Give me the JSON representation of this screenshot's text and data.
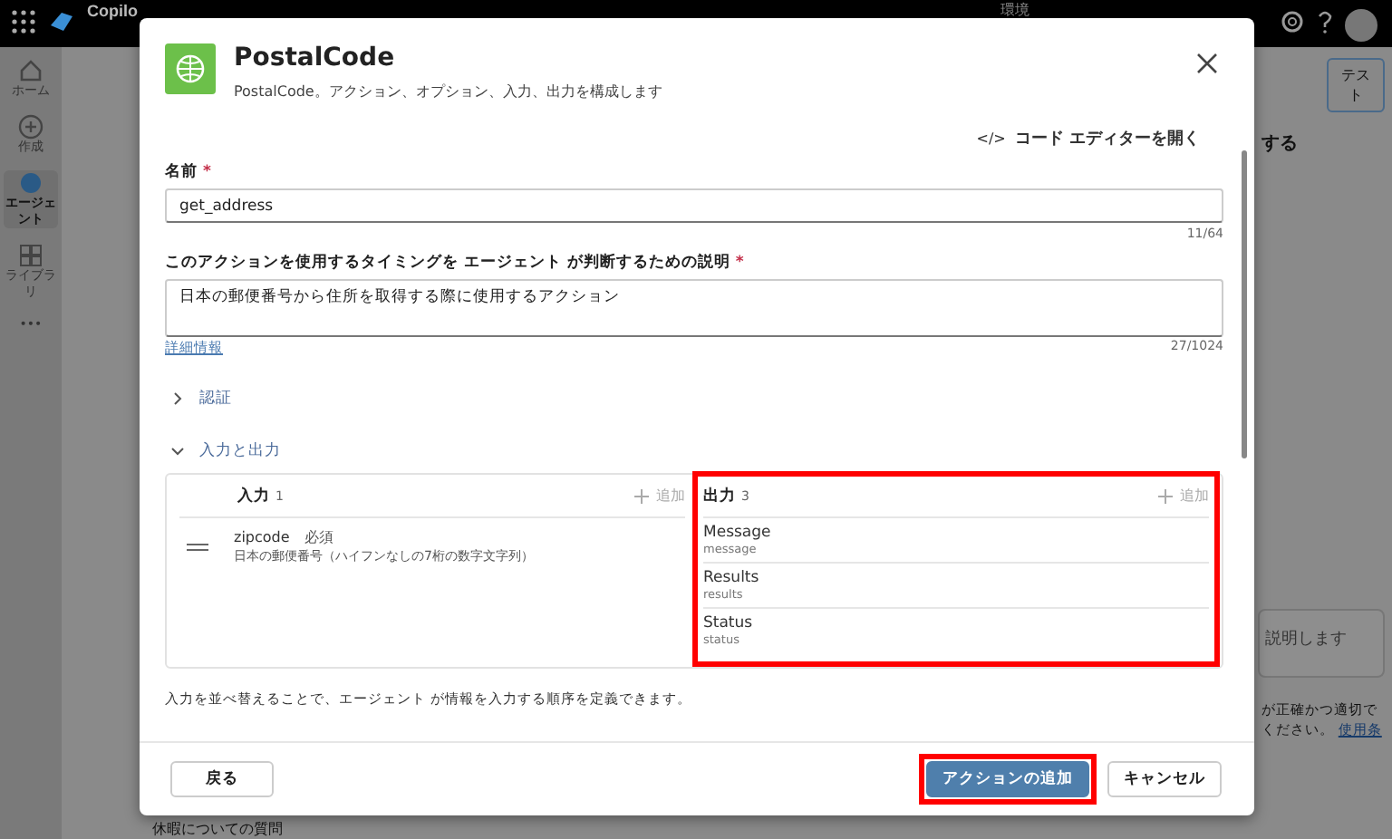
{
  "top_bar": {
    "app_name": "Copilo",
    "environment_label": "環境"
  },
  "rail": [
    {
      "label": "ホーム",
      "selected": false
    },
    {
      "label": "作成",
      "selected": false
    },
    {
      "label": "エージェント",
      "selected": true
    },
    {
      "label": "ライブラリ",
      "selected": false
    },
    {
      "label": "•••",
      "selected": false
    }
  ],
  "test_panel": {
    "test_button": "テスト",
    "title_fragment": "する",
    "chat_placeholder": "説明します",
    "disclaimer": "が正確かつ適切で",
    "disclaimer_2": "ください。",
    "terms_link": "使用条"
  },
  "background_item": "休暇についての質問",
  "dialog": {
    "title": "PostalCode",
    "subtitle": "PostalCode。アクション、オプション、入力、出力を構成します",
    "code_icon": "</>",
    "code_editor_link": "コード エディターを開く",
    "name_field": {
      "label": "名前",
      "required_mark": "*",
      "value": "get_address",
      "counter": "11/64"
    },
    "description_field": {
      "label": "このアクションを使用するタイミングを エージェント が判断するための説明",
      "required_mark": "*",
      "value": "日本の郵便番号から住所を取得する際に使用するアクション",
      "counter": "27/1024"
    },
    "details_link": "詳細情報",
    "sections": [
      {
        "label": "認証",
        "expanded": false
      },
      {
        "label": "入力と出力",
        "expanded": true
      }
    ],
    "inputs": {
      "title": "入力",
      "count": "1",
      "add": "追加",
      "items": [
        {
          "name": "zipcode",
          "required_tag": "必須",
          "description": "日本の郵便番号（ハイフンなしの7桁の数字文字列）"
        }
      ]
    },
    "outputs": {
      "title": "出力",
      "count": "3",
      "add": "追加",
      "highlighted": true,
      "items": [
        {
          "name": "Message",
          "id": "message"
        },
        {
          "name": "Results",
          "id": "results"
        },
        {
          "name": "Status",
          "id": "status"
        }
      ]
    },
    "reorder_note": "入力を並べ替えることで、エージェント が情報を入力する順序を定義できます。",
    "buttons": [
      {
        "label": "戻る",
        "kind": "back",
        "highlighted": false
      },
      {
        "label": "アクションの追加",
        "kind": "primary",
        "highlighted": true
      },
      {
        "label": "キャンセル",
        "kind": "secondary",
        "highlighted": false
      }
    ]
  }
}
